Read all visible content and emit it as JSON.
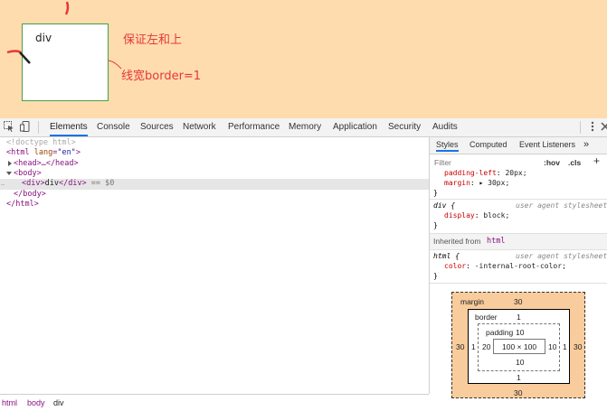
{
  "page": {
    "div_text": "div",
    "annotation_top": "保证左和上",
    "annotation_border": "线宽border=1"
  },
  "colors": {
    "margin_bg": "#ffdcae",
    "accent": "#1a73e8",
    "annotation": "#e53935"
  },
  "toolbar": {
    "tabs": [
      "Elements",
      "Console",
      "Sources",
      "Network",
      "Performance",
      "Memory",
      "Application",
      "Security",
      "Audits"
    ],
    "active_tab": "Elements",
    "icons": [
      "inspect-icon",
      "device-icon",
      "kebab-menu-icon",
      "close-icon"
    ]
  },
  "elements": {
    "lines": {
      "doctype": "<!doctype html>",
      "html_open_tag": "<html ",
      "html_attr": "lang",
      "html_eq": "=",
      "html_val": "\"en\"",
      "html_close_bracket": ">",
      "head": "<head>…</head>",
      "body_open": "<body>",
      "div_open": "<div>",
      "div_text": "div",
      "div_close": "</div>",
      "div_eq": " == $0",
      "body_close": "</body>",
      "html_close": "</html>"
    },
    "gutter_dots": "…"
  },
  "breadcrumb": [
    "html",
    "body",
    "div"
  ],
  "styles": {
    "tabs": [
      "Styles",
      "Computed",
      "Event Listeners"
    ],
    "more": "»",
    "filter_placeholder": "Filter",
    "hov": ":hov",
    "cls": ".cls",
    "plus": "+",
    "rule1": {
      "props": [
        {
          "name": "padding-left",
          "value": "20px;"
        },
        {
          "name": "margin",
          "value": "30px;"
        }
      ],
      "close": "}"
    },
    "rule2": {
      "selector": "div {",
      "source": "user agent stylesheet",
      "prop": "display",
      "value": "block;",
      "close": "}"
    },
    "inherited_label": "Inherited from",
    "inherited_tag": "html",
    "rule3": {
      "selector": "html {",
      "source": "user agent stylesheet",
      "prop": "color",
      "value": "-internal-root-color;",
      "close": "}"
    }
  },
  "box_model": {
    "margin_label": "margin",
    "margin_top": "30",
    "margin_bottom": "30",
    "margin_left": "30",
    "margin_right": "30",
    "border_label": "border",
    "border_top": "1",
    "border_bottom": "1",
    "border_left": "1",
    "border_right": "1",
    "padding_label": "padding",
    "padding_top": "10",
    "padding_bottom": "10",
    "padding_left": "20",
    "padding_right": "10",
    "content": "100 × 100"
  }
}
